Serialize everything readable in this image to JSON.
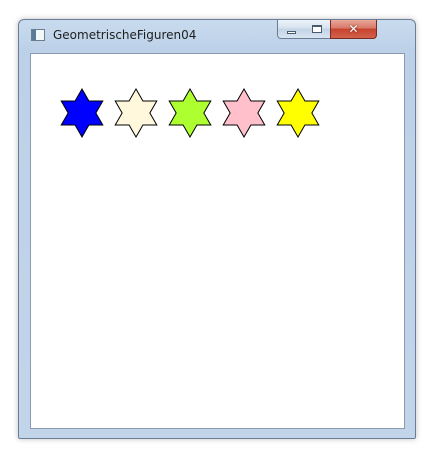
{
  "window": {
    "title": "GeometrischeFiguren04",
    "controls": {
      "minimize_icon": "minimize-icon",
      "maximize_icon": "maximize-icon",
      "close_icon": "close-icon",
      "close_glyph": "✕"
    }
  },
  "canvas": {
    "stars": [
      {
        "name": "star-blue",
        "fill": "#0000ff"
      },
      {
        "name": "star-cornsilk",
        "fill": "#fff8dc"
      },
      {
        "name": "star-greenyellow",
        "fill": "#adff2f"
      },
      {
        "name": "star-pink",
        "fill": "#ffc0cb"
      },
      {
        "name": "star-yellow",
        "fill": "#ffff00"
      }
    ],
    "stroke": "#000000"
  }
}
